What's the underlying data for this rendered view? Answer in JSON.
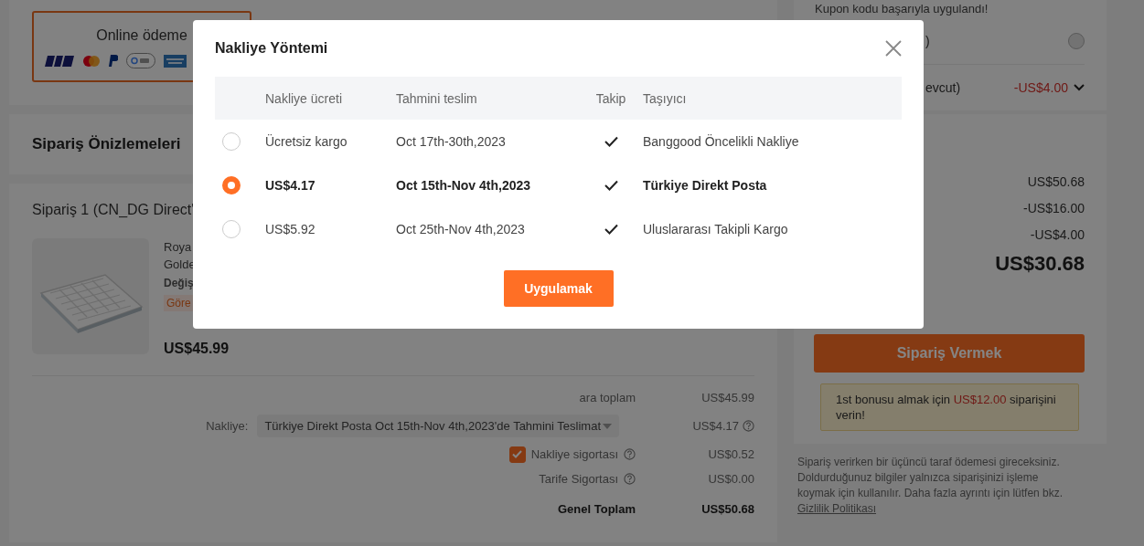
{
  "payment_card": {
    "title": "Online ödeme"
  },
  "order_preview": {
    "title": "Sipariş Önizlemeleri"
  },
  "order": {
    "title": "Sipariş 1 (CN_DG Direct'",
    "product": {
      "title_lines": [
        "Roya",
        "Golde"
      ],
      "option": "Değiş",
      "tag": "Göre",
      "price": "US$45.99"
    },
    "summary": [
      {
        "kind": "plain",
        "label": "ara toplam",
        "value": "US$45.99",
        "help": false
      },
      {
        "kind": "shipping",
        "label": "Nakliye:",
        "select": "Türkiye Direkt Posta Oct 15th-Nov 4th,2023'de Tahmini Teslimat",
        "value": "US$4.17",
        "help": true
      },
      {
        "kind": "check",
        "label": "Nakliye sigortası",
        "checked": true,
        "value": "US$0.52",
        "help": true
      },
      {
        "kind": "plain",
        "label": "Tarife Sigortası",
        "value": "US$0.00",
        "help": true
      },
      {
        "kind": "total",
        "label": "Genel Toplam",
        "value": "US$50.68",
        "help": false
      }
    ]
  },
  "sidebar": {
    "coupon_note": "Kupon kodu başarıyla uygulandı!",
    "options": [
      {
        "kind": "radio",
        "label": ")",
        "selected": false
      },
      {
        "kind": "discount",
        "label": "evcut)",
        "value": "-US$4.00"
      }
    ],
    "amounts": [
      "US$50.68",
      "-US$16.00",
      "-US$4.00"
    ],
    "total": "US$30.68",
    "place_order": "Sipariş Vermek",
    "bonus_note": {
      "before": "1st bonusu almak için ",
      "amount": "US$12.00",
      "after": " siparişini verin!"
    },
    "disclaimer": {
      "text": "Sipariş verirken bir üçüncü taraf ödemesi gireceksiniz. Doldurduğunuz bilgiler yalnızca siparişinizi işleme koymak için kullanılır. Daha fazla ayrıntı için lütfen bkz.",
      "link": "Gizlilik Politikası"
    }
  },
  "modal": {
    "title": "Nakliye Yöntemi",
    "columns": [
      "Nakliye ücreti",
      "Tahmini teslim",
      "Takip",
      "Taşıyıcı"
    ],
    "rows": [
      {
        "fee": "Ücretsiz kargo",
        "delivery": "Oct 17th-30th,2023",
        "tracking": true,
        "carrier": "Banggood Öncelikli Nakliye",
        "selected": false
      },
      {
        "fee": "US$4.17",
        "delivery": "Oct 15th-Nov 4th,2023",
        "tracking": true,
        "carrier": "Türkiye Direkt Posta",
        "selected": true
      },
      {
        "fee": "US$5.92",
        "delivery": "Oct 25th-Nov 4th,2023",
        "tracking": true,
        "carrier": "Uluslararası Takipli Kargo",
        "selected": false
      }
    ],
    "apply": "Uygulamak"
  }
}
